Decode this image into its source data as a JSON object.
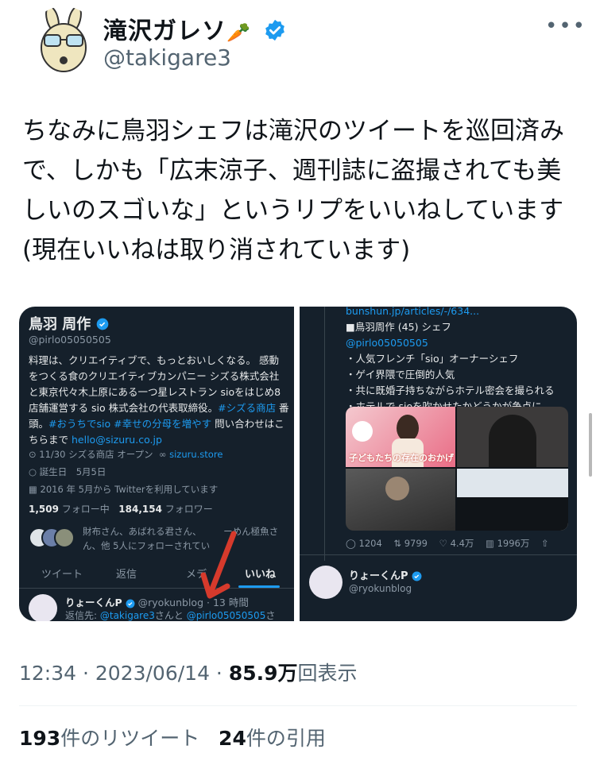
{
  "author": {
    "name": "滝沢ガレソ",
    "emoji": "🥕",
    "handle": "@takigare3",
    "verified_color": "#1d9bf0"
  },
  "tweet_text": "ちなみに鳥羽シェフは滝沢のツイートを巡回済みで、しかも「広末涼子、週刊誌に盗撮されても美しいのスゴいな」というリプをいいねしています(現在いいねは取り消されています)",
  "left_image": {
    "profile_name": "鳥羽 周作",
    "profile_handle": "@pirlo05050505",
    "bio_1": "料理は、クリエイティブで、もっとおいしくなる。 感動",
    "bio_2": "をつくる食のクリエイティブカンパニー シズる株式会社",
    "bio_3": "と東京代々木上原にある一つ星レストラン sioをはじめ8",
    "bio_4": "店舗運営する sio 株式会社の代表取締役。",
    "bio_tag1": "#シズる商店",
    "bio_5": " 番",
    "bio_6": "頭。",
    "bio_tag2": "#おうちでsio",
    "bio_tag3": "#幸せの分母を増やす",
    "bio_7": " 問い合わせはこ",
    "bio_8": "ちらまで ",
    "bio_email": "hello@sizuru.co.jp",
    "location": "11/30 シズる商店 オープン",
    "website": "sizuru.store",
    "birthday": "誕生日　5月5日",
    "joined": "2016 年 5月から Twitterを利用しています",
    "following_count": "1,509",
    "following_label": "フォロー中",
    "followers_count": "184,154",
    "followers_label": "フォロワー",
    "followed_by_1": "財布さん、あばれる君さん、 ",
    "followed_by_1b": "ーめん極魚さ",
    "followed_by_2": "ん、他 5人にフォローされてい",
    "tabs": [
      "ツイート",
      "返信",
      "メデ",
      "いいね"
    ],
    "reply_name": "りょーくんP",
    "reply_handle": "@ryokunblog",
    "reply_time": "· 13 時間",
    "reply_to_prefix": "返信先: ",
    "reply_to_1": "@takigare3",
    "reply_to_mid": "さんと ",
    "reply_to_2": "@pirlo05050505",
    "reply_to_suffix": "さ"
  },
  "right_image": {
    "url": "bunshun.jp/articles/-/634...",
    "line_1": "■鳥羽周作 (45) シェフ",
    "line_2": "@pirlo05050505",
    "line_3": "・人気フレンチ「sio」オーナーシェフ",
    "line_4": "・ゲイ界隈で圧倒的人気",
    "line_5": "・共に既婚子持ちながらホテル密会を撮られる",
    "line_6": "・ホテルで sioを吹かせたかどうかが争点に",
    "collage_caption": "子どもたちの存在のおかげ",
    "replies": "1204",
    "retweets": "9799",
    "likes": "4.4万",
    "views": "1996万",
    "reply_name": "りょーくんP",
    "reply_handle": "@ryokunblog"
  },
  "meta": {
    "time": "12:34",
    "date": "2023/06/14",
    "views_count": "85.9万",
    "views_label": "回表示"
  },
  "stats": {
    "retweets_count": "193",
    "retweets_label": "件のリツイート",
    "quotes_count": "24",
    "quotes_label": "件の引用"
  },
  "colors": {
    "accent": "#1d9bf0",
    "dark_bg": "#15202b",
    "arrow": "#d63a2c",
    "pink_tag": "#f91880"
  }
}
